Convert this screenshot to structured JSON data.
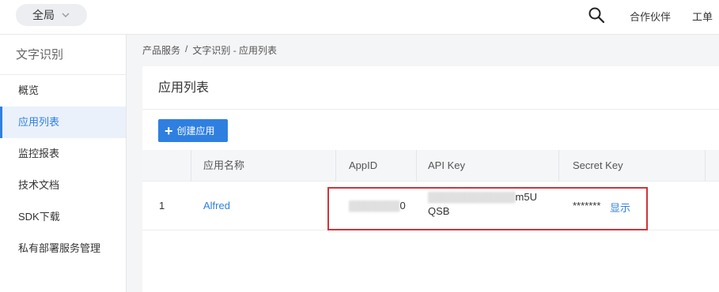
{
  "topbar": {
    "scope_label": "全局",
    "search_icon": "search-icon",
    "links": [
      "合作伙伴",
      "工单"
    ]
  },
  "sidebar": {
    "title": "文字识别",
    "items": [
      {
        "label": "概览",
        "active": false
      },
      {
        "label": "应用列表",
        "active": true
      },
      {
        "label": "监控报表",
        "active": false
      },
      {
        "label": "技术文档",
        "active": false
      },
      {
        "label": "SDK下载",
        "active": false
      },
      {
        "label": "私有部署服务管理",
        "active": false
      }
    ]
  },
  "breadcrumb": {
    "parts": [
      "产品服务",
      "/",
      "文字识别 - 应用列表"
    ]
  },
  "main": {
    "title": "应用列表",
    "create_button": "创建应用",
    "table": {
      "headers": [
        "应用名称",
        "AppID",
        "API Key",
        "Secret Key"
      ],
      "rows": [
        {
          "index": "1",
          "name": "Alfred",
          "app_id_visible": "0",
          "api_key_line1_visible": "m5U",
          "api_key_line2": "QSB",
          "secret_key": "*******",
          "show_label": "显示"
        }
      ]
    }
  },
  "colors": {
    "accent": "#2f7fe0",
    "highlight": "#d0343b"
  }
}
